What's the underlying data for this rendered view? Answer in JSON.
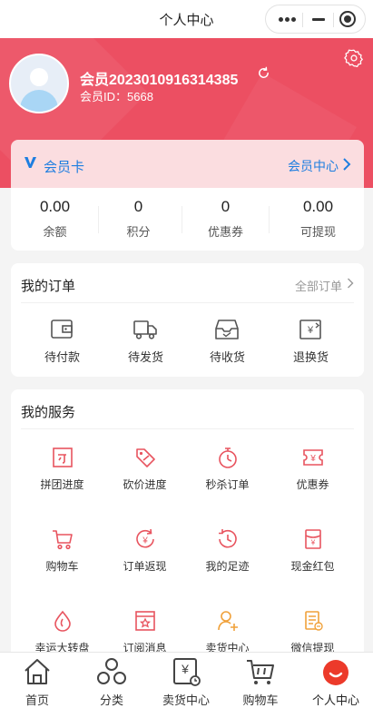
{
  "topbar": {
    "title": "个人中心"
  },
  "profile": {
    "name": "会员202301091631438​5",
    "id_label": "会员ID：5668"
  },
  "member_card": {
    "label": "会员卡",
    "link": "会员中心"
  },
  "stats": [
    {
      "value": "0.00",
      "label": "余额"
    },
    {
      "value": "0",
      "label": "积分"
    },
    {
      "value": "0",
      "label": "优惠券"
    },
    {
      "value": "0.00",
      "label": "可提现"
    }
  ],
  "orders": {
    "title": "我的订单",
    "all_label": "全部订单",
    "items": [
      {
        "label": "待付款",
        "icon": "wallet-icon"
      },
      {
        "label": "待发货",
        "icon": "truck-icon"
      },
      {
        "label": "待收货",
        "icon": "inbox-icon"
      },
      {
        "label": "退换货",
        "icon": "return-icon"
      }
    ]
  },
  "services": {
    "title": "我的服务",
    "items": [
      {
        "label": "拼团进度",
        "icon": "group-buy-icon"
      },
      {
        "label": "砍价进度",
        "icon": "bargain-tag-icon"
      },
      {
        "label": "秒杀订单",
        "icon": "stopwatch-icon"
      },
      {
        "label": "优惠券",
        "icon": "coupon-icon"
      },
      {
        "label": "购物车",
        "icon": "cart-icon"
      },
      {
        "label": "订单返现",
        "icon": "cashback-icon"
      },
      {
        "label": "我的足迹",
        "icon": "history-icon"
      },
      {
        "label": "现金红包",
        "icon": "red-packet-icon"
      },
      {
        "label": "幸运大转盘",
        "icon": "lucky-wheel-icon"
      },
      {
        "label": "订阅消息",
        "icon": "subscribe-icon"
      },
      {
        "label": "卖货中心",
        "icon": "add-user-icon"
      },
      {
        "label": "微信提现",
        "icon": "withdraw-icon"
      }
    ]
  },
  "tabbar": [
    {
      "label": "首页",
      "icon": "home-icon"
    },
    {
      "label": "分类",
      "icon": "category-icon"
    },
    {
      "label": "卖货中心",
      "icon": "sell-icon"
    },
    {
      "label": "购物车",
      "icon": "cart-icon"
    },
    {
      "label": "个人中心",
      "icon": "profile-icon",
      "active": true
    }
  ],
  "colors": {
    "brand": "#ec4f62",
    "link": "#1e7ee0",
    "service_icon": "#e8545f",
    "service_icon_alt": "#f0a13a"
  }
}
